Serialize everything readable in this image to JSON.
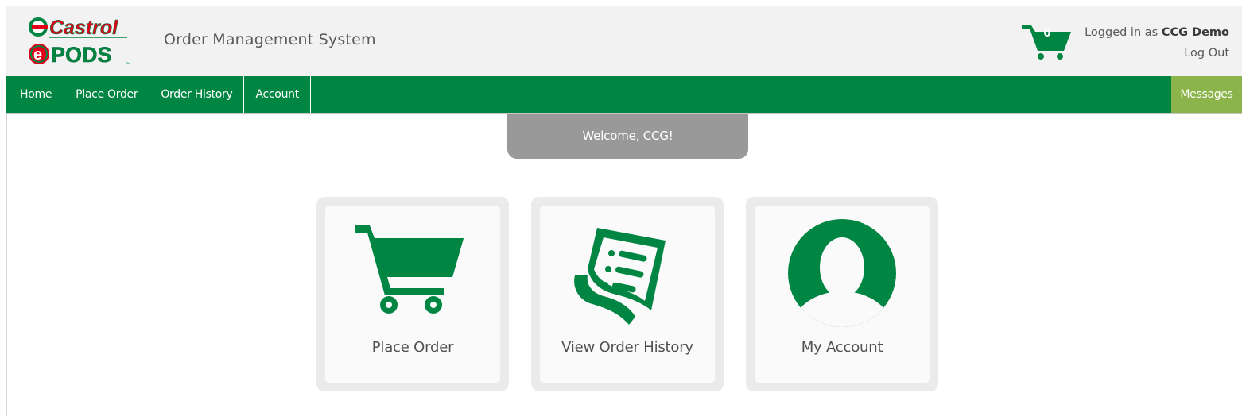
{
  "header": {
    "logo_top": "Castrol",
    "logo_bottom": "PODS",
    "logo_e": "e",
    "app_title": "Order Management System",
    "cart_count": "0",
    "logged_in_prefix": "Logged in as",
    "user_name": "CCG Demo",
    "logout_label": "Log Out"
  },
  "nav": {
    "items": [
      {
        "label": "Home"
      },
      {
        "label": "Place Order"
      },
      {
        "label": "Order History"
      },
      {
        "label": "Account"
      }
    ],
    "messages_label": "Messages"
  },
  "welcome": {
    "text": "Welcome, CCG!"
  },
  "tiles": [
    {
      "label": "Place Order",
      "icon": "cart-icon"
    },
    {
      "label": "View Order History",
      "icon": "receipt-icon"
    },
    {
      "label": "My Account",
      "icon": "user-icon"
    }
  ],
  "colors": {
    "brand_green": "#008542",
    "messages_green": "#8bb54a",
    "castrol_red": "#e2001a",
    "banner_gray": "#999999",
    "header_bg": "#f2f2f2"
  }
}
